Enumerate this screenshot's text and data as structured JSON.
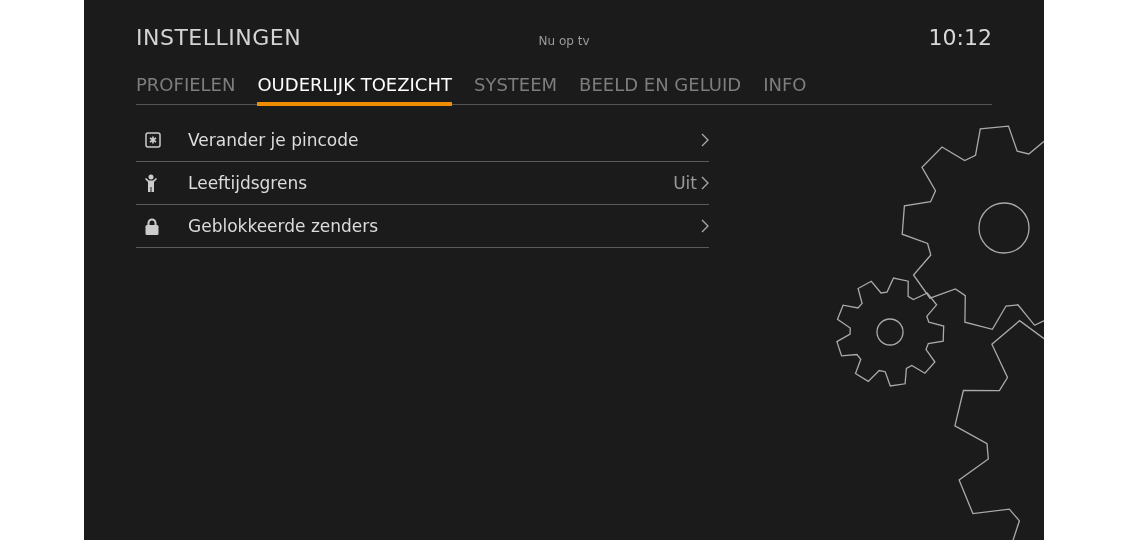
{
  "header": {
    "title": "INSTELLINGEN",
    "now_on_tv": "Nu op tv",
    "clock": "10:12"
  },
  "tabs": [
    {
      "label": "PROFIELEN",
      "selected": false
    },
    {
      "label": "OUDERLIJK TOEZICHT",
      "selected": true
    },
    {
      "label": "SYSTEEM",
      "selected": false
    },
    {
      "label": "BEELD EN GELUID",
      "selected": false
    },
    {
      "label": "INFO",
      "selected": false
    }
  ],
  "items": [
    {
      "kind": "pin",
      "label": "Verander je pincode"
    },
    {
      "kind": "child",
      "label": "Leeftijdsgrens",
      "value": "Uit"
    },
    {
      "kind": "lock",
      "label": "Geblokkeerde zenders"
    }
  ]
}
